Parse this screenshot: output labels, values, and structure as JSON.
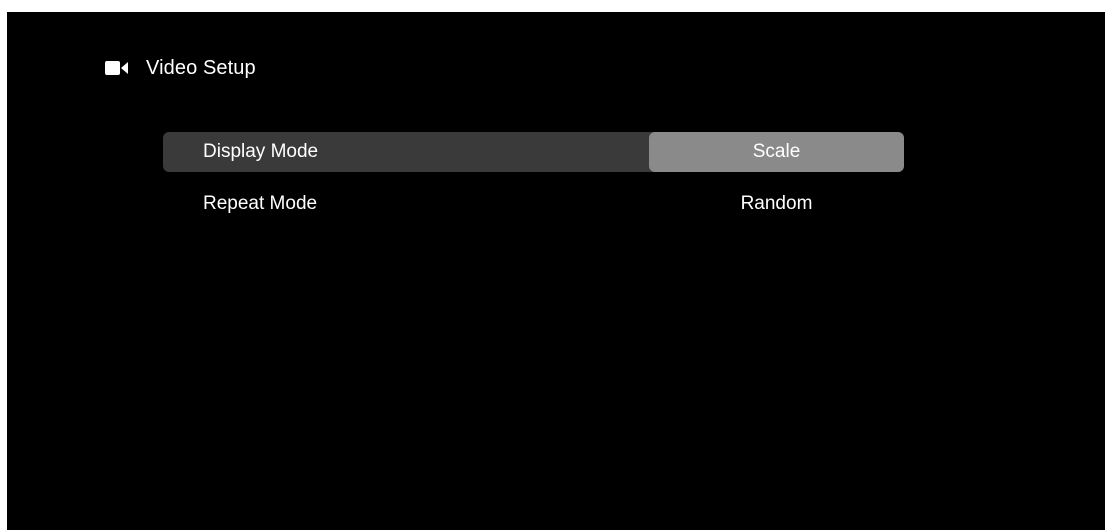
{
  "header": {
    "icon": "video-camera-icon",
    "title": "Video Setup"
  },
  "menu": {
    "items": [
      {
        "label": "Display Mode",
        "value": "Scale",
        "selected": true
      },
      {
        "label": "Repeat Mode",
        "value": "Random",
        "selected": false
      }
    ]
  },
  "colors": {
    "background": "#000000",
    "selected_row": "#3a3a3a",
    "selected_value": "#8a8a8a",
    "text": "#ffffff"
  }
}
